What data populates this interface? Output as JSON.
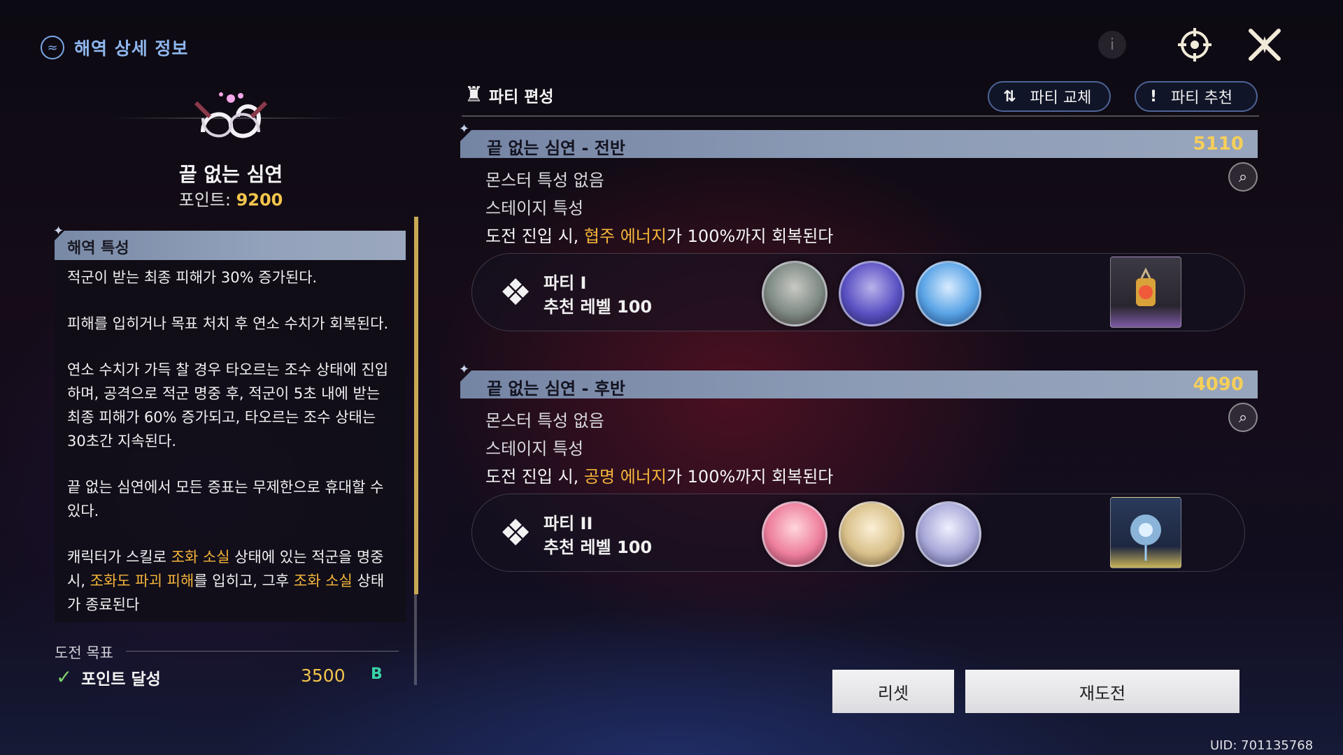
{
  "header": {
    "title": "해역 상세 정보",
    "icon": "sea-emblem-icon"
  },
  "top_icons": [
    {
      "name": "info-icon"
    },
    {
      "name": "compass-icon"
    },
    {
      "name": "close-icon"
    }
  ],
  "mode": {
    "name": "끝 없는 심연",
    "points_label": "포인트: ",
    "points_value": "9200"
  },
  "info": {
    "title": "해역 특성",
    "paragraphs": [
      "적군이 받는 최종 피해가 30% 증가된다.",
      "피해를 입히거나 목표 처치 후 연소 수치가 회복된다.",
      "연소 수치가 가득 찰 경우 타오르는 조수 상태에 진입하며, 공격으로 적군 명중 후, 적군이 5초 내에 받는 최종 피해가 60% 증가되고, 타오르는 조수 상태는 30초간 지속된다.",
      "끝 없는 심연에서 모든 증표는 무제한으로 휴대할 수 있다."
    ],
    "p5": {
      "a": "캐릭터가 스킬로 ",
      "b": "조화 소실",
      "c": " 상태에 있는 적군을 명중 시, ",
      "d": "조화도 파괴 피해",
      "e": "를 입히고, 그후 ",
      "f": "조화 소실",
      "g": " 상태가 종료된다"
    }
  },
  "goal": {
    "label": "도전 목표",
    "name": "포인트 달성",
    "value": "3500",
    "badge": "B"
  },
  "party": {
    "title": "파티 편성",
    "swap_label": "파티 교체",
    "recommend_label": "파티 추천"
  },
  "stages": [
    {
      "name": "끝 없는 심연 - 전반",
      "score": "5110",
      "monster_trait": "몬스터 특성 없음",
      "stage_trait_label": "스테이지 특성",
      "desc_a": "도전 진입 시, ",
      "desc_b": "협주 에너지",
      "desc_c": "가 100%까지 회복된다",
      "party_name": "파티 I",
      "party_level": "추천 레벨 100"
    },
    {
      "name": "끝 없는 심연 - 후반",
      "score": "4090",
      "monster_trait": "몬스터 특성 없음",
      "stage_trait_label": "스테이지 특성",
      "desc_a": "도전 진입 시, ",
      "desc_b": "공명 에너지",
      "desc_c": "가 100%까지 회복된다",
      "party_name": "파티 II",
      "party_level": "추천 레벨 100"
    }
  ],
  "buttons": {
    "reset": "리셋",
    "retry": "재도전"
  },
  "uid": "UID: 701135768",
  "colors": {
    "highlight": "#f5b43a",
    "score": "#f6cf5a",
    "header_blue": "#8fb6ee"
  }
}
